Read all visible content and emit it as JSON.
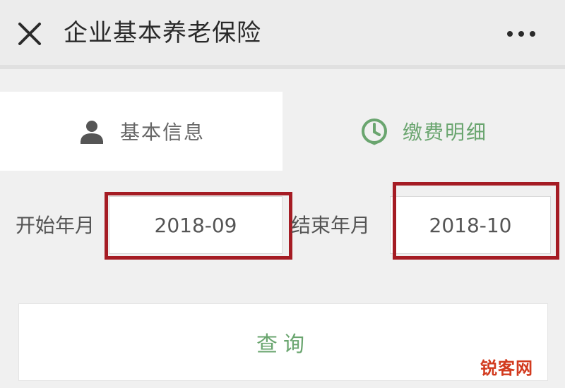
{
  "header": {
    "title": "企业基本养老保险",
    "close_icon": "close-icon",
    "more_icon": "more-horizontal-icon"
  },
  "tabs": [
    {
      "label": "基本信息",
      "icon": "person-icon",
      "active": true
    },
    {
      "label": "缴费明细",
      "icon": "clock-icon",
      "active": false
    }
  ],
  "query_form": {
    "start_label": "开始年月",
    "start_value": "2018-09",
    "end_label": "结束年月",
    "end_value": "2018-10",
    "submit_label": "查询"
  },
  "watermark": "锐客网",
  "colors": {
    "accent_green": "#6aa56f",
    "highlight_red": "#a51c24",
    "watermark_red": "#d23a1e"
  }
}
